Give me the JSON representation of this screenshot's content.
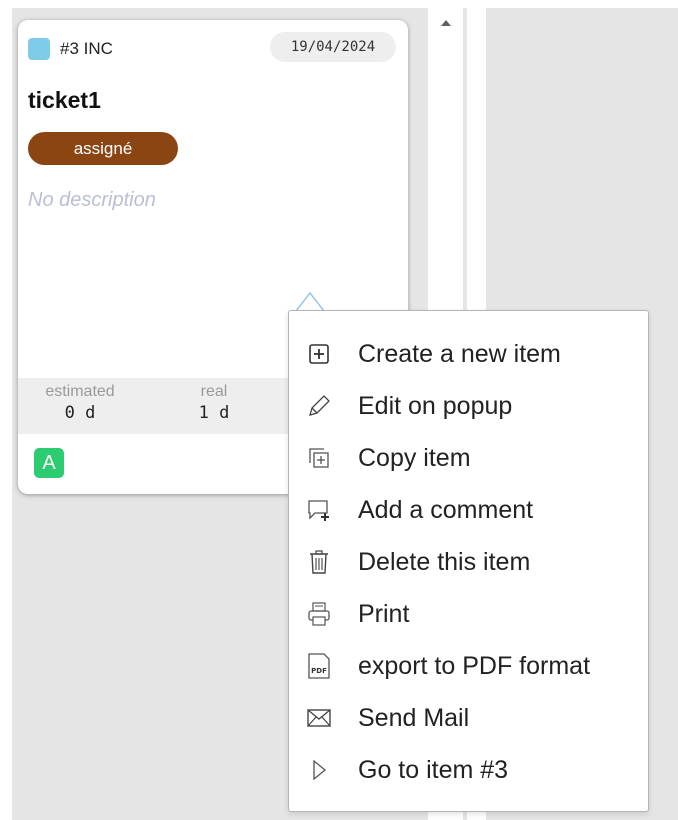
{
  "card": {
    "type_color": "#7ecbea",
    "reference": "#3 INC",
    "date": "19/04/2024",
    "title": "ticket1",
    "status": "assigné",
    "status_color": "#8a4513",
    "description": "No description",
    "metrics": {
      "estimated_label": "estimated",
      "estimated_value": "0 d",
      "real_label": "real",
      "real_value": "1 d"
    },
    "assignee_initial": "A",
    "assignee_color": "#2ecc71"
  },
  "context_menu": {
    "items": [
      {
        "icon": "plus-square-icon",
        "label": "Create a new item"
      },
      {
        "icon": "pencil-icon",
        "label": "Edit on popup"
      },
      {
        "icon": "copy-icon",
        "label": "Copy item"
      },
      {
        "icon": "comment-add-icon",
        "label": "Add a comment"
      },
      {
        "icon": "trash-icon",
        "label": "Delete this item"
      },
      {
        "icon": "printer-icon",
        "label": "Print"
      },
      {
        "icon": "pdf-file-icon",
        "label": "export to PDF format"
      },
      {
        "icon": "envelope-icon",
        "label": "Send Mail"
      },
      {
        "icon": "play-outline-icon",
        "label": "Go to item #3"
      }
    ]
  }
}
